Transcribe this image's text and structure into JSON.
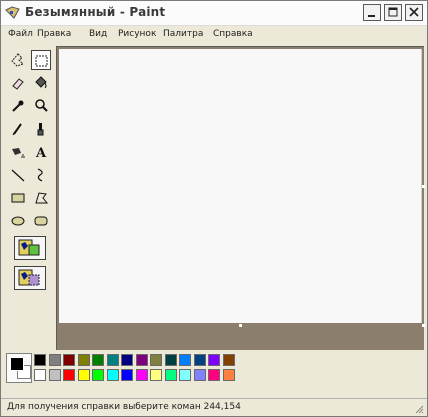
{
  "window": {
    "title": "Безымянный - Paint"
  },
  "menu": {
    "items": [
      "Файл",
      "Правка",
      "Вид",
      "Рисунок",
      "Палитра",
      "Справка"
    ]
  },
  "toolbox": {
    "tools": [
      {
        "name": "free-form-select",
        "icon": "free-form-select-icon"
      },
      {
        "name": "select",
        "icon": "rect-select-icon",
        "selected": true
      },
      {
        "name": "eraser",
        "icon": "eraser-icon"
      },
      {
        "name": "fill",
        "icon": "fill-bucket-icon"
      },
      {
        "name": "pick-color",
        "icon": "eyedropper-icon"
      },
      {
        "name": "magnifier",
        "icon": "magnifier-icon"
      },
      {
        "name": "pencil",
        "icon": "pencil-icon"
      },
      {
        "name": "brush",
        "icon": "brush-icon"
      },
      {
        "name": "airbrush",
        "icon": "airbrush-icon"
      },
      {
        "name": "text",
        "icon": "text-icon"
      },
      {
        "name": "line",
        "icon": "line-icon"
      },
      {
        "name": "curve",
        "icon": "curve-icon"
      },
      {
        "name": "rectangle",
        "icon": "rectangle-icon"
      },
      {
        "name": "polygon",
        "icon": "polygon-icon"
      },
      {
        "name": "ellipse",
        "icon": "ellipse-icon"
      },
      {
        "name": "rounded-rectangle",
        "icon": "rounded-rectangle-icon"
      }
    ],
    "text_tool_glyph": "A"
  },
  "palette": {
    "foreground": "#000000",
    "background": "#ffffff",
    "row1": [
      "#000000",
      "#808080",
      "#800000",
      "#808000",
      "#008000",
      "#008080",
      "#000080",
      "#800080",
      "#808040",
      "#004040",
      "#0080ff",
      "#004080",
      "#8000ff",
      "#804000"
    ],
    "row2": [
      "#ffffff",
      "#c0c0c0",
      "#ff0000",
      "#ffff00",
      "#00ff00",
      "#00ffff",
      "#0000ff",
      "#ff00ff",
      "#ffff80",
      "#00ff80",
      "#80ffff",
      "#8080ff",
      "#ff0080",
      "#ff8040"
    ]
  },
  "status": {
    "text": "Для получения справки выберите коман 244,154"
  }
}
